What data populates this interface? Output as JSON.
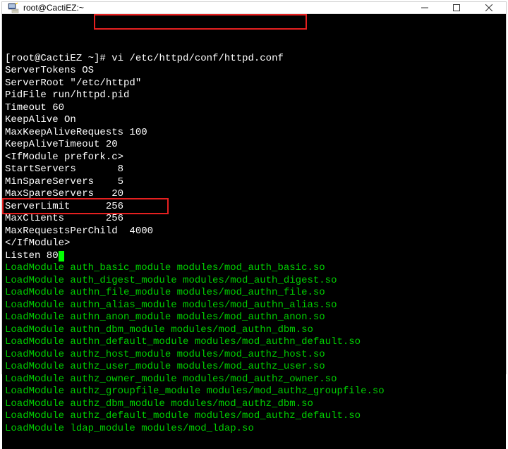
{
  "window": {
    "title": "root@CactiEZ:~"
  },
  "prompt": {
    "text": "[root@CactiEZ ~]# ",
    "command": "vi /etc/httpd/conf/httpd.conf"
  },
  "lines": [
    "ServerTokens OS",
    "ServerRoot \"/etc/httpd\"",
    "PidFile run/httpd.pid",
    "Timeout 60",
    "KeepAlive On",
    "MaxKeepAliveRequests 100",
    "KeepAliveTimeout 20",
    "<IfModule prefork.c>",
    "StartServers       8",
    "MinSpareServers    5",
    "MaxSpareServers   20",
    "ServerLimit      256",
    "MaxClients       256",
    "MaxRequestsPerChild  4000",
    "</IfModule>"
  ],
  "listen_line": "Listen 80",
  "green_lines": [
    "LoadModule auth_basic_module modules/mod_auth_basic.so",
    "LoadModule auth_digest_module modules/mod_auth_digest.so",
    "LoadModule authn_file_module modules/mod_authn_file.so",
    "LoadModule authn_alias_module modules/mod_authn_alias.so",
    "LoadModule authn_anon_module modules/mod_authn_anon.so",
    "LoadModule authn_dbm_module modules/mod_authn_dbm.so",
    "LoadModule authn_default_module modules/mod_authn_default.so",
    "LoadModule authz_host_module modules/mod_authz_host.so",
    "LoadModule authz_user_module modules/mod_authz_user.so",
    "LoadModule authz_owner_module modules/mod_authz_owner.so",
    "LoadModule authz_groupfile_module modules/mod_authz_groupfile.so",
    "LoadModule authz_dbm_module modules/mod_authz_dbm.so",
    "LoadModule authz_default_module modules/mod_authz_default.so",
    "LoadModule ldap_module modules/mod_ldap.so"
  ]
}
